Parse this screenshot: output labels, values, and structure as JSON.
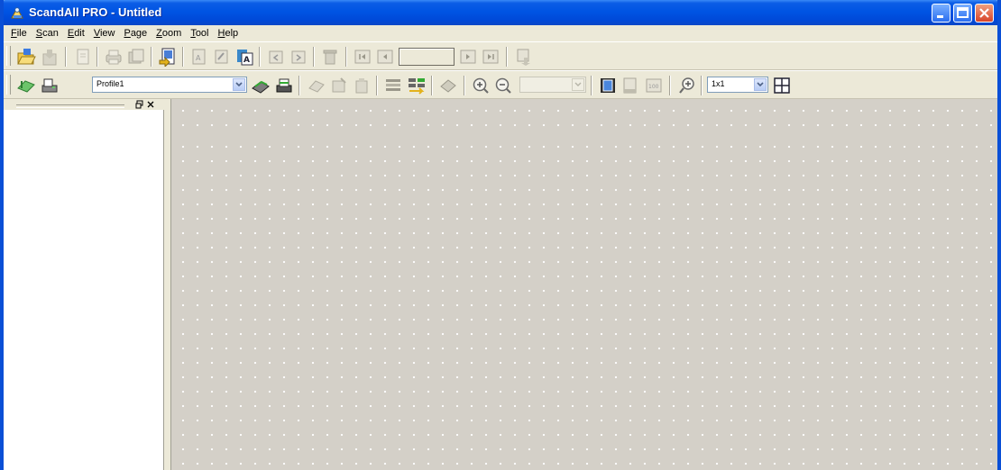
{
  "window": {
    "title": "ScandAll PRO - Untitled"
  },
  "menu": [
    {
      "label": "File",
      "mnemonic": "F",
      "rest": "ile"
    },
    {
      "label": "Scan",
      "mnemonic": "S",
      "rest": "can"
    },
    {
      "label": "Edit",
      "mnemonic": "E",
      "rest": "dit"
    },
    {
      "label": "View",
      "mnemonic": "V",
      "rest": "iew"
    },
    {
      "label": "Page",
      "mnemonic": "P",
      "rest": "age"
    },
    {
      "label": "Zoom",
      "mnemonic": "Z",
      "rest": "oom"
    },
    {
      "label": "Tool",
      "mnemonic": "T",
      "rest": "ool"
    },
    {
      "label": "Help",
      "mnemonic": "H",
      "rest": "elp"
    }
  ],
  "toolbar2": {
    "profile_value": "Profile1",
    "layout_value": "1x1",
    "zoom_value": ""
  },
  "colors": {
    "titlebar": "#0054e3",
    "canvas": "#d4d0c8",
    "chrome": "#ece9d8"
  }
}
